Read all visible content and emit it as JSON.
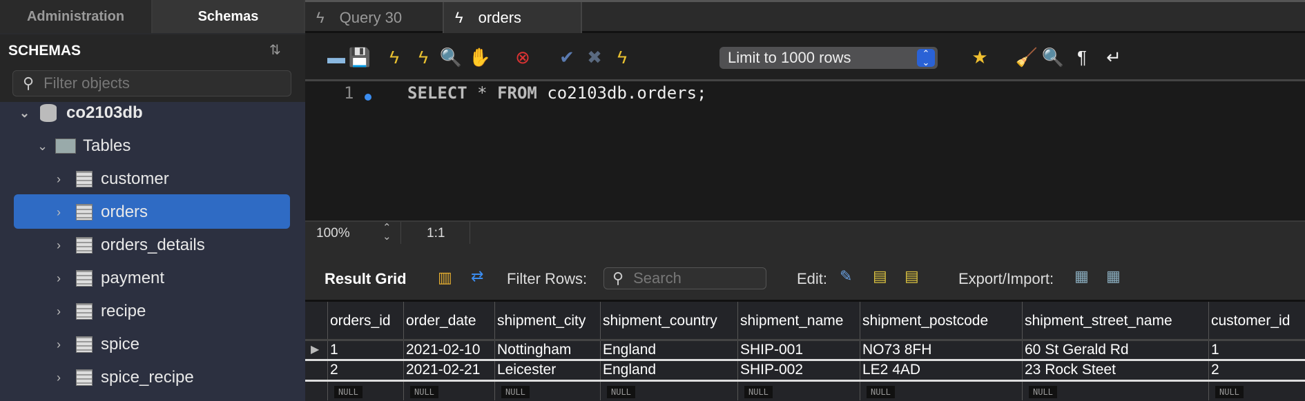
{
  "sidebar": {
    "tabs": [
      "Administration",
      "Schemas"
    ],
    "title": "SCHEMAS",
    "filter_placeholder": "Filter objects",
    "schema": "co2103db",
    "tables_label": "Tables",
    "tables": [
      "customer",
      "orders",
      "orders_details",
      "payment",
      "recipe",
      "spice",
      "spice_recipe"
    ],
    "selected": "orders"
  },
  "query_tabs": [
    "Query 30",
    "orders"
  ],
  "toolbar": {
    "limit": "Limit to 1000 rows",
    "icons": [
      "open-folder-icon",
      "save-icon",
      "execute-icon",
      "execute-current-icon",
      "explain-icon",
      "stop-icon",
      "toggle-error-icon",
      "commit-icon",
      "rollback-icon",
      "autocommit-icon",
      "add-snippet-icon",
      "beautify-icon",
      "find-icon",
      "invisible-chars-icon",
      "word-wrap-icon"
    ]
  },
  "editor": {
    "line": "1",
    "sql_keyword1": "SELECT",
    "sql_star": "*",
    "sql_keyword2": "FROM",
    "sql_rest": "co2103db.orders;"
  },
  "status": {
    "zoom": "100%",
    "position": "1:1"
  },
  "result": {
    "title": "Result Grid",
    "filter_label": "Filter Rows:",
    "search_placeholder": "Search",
    "edit_label": "Edit:",
    "export_label": "Export/Import:"
  },
  "grid": {
    "columns": [
      "orders_id",
      "order_date",
      "shipment_city",
      "shipment_country",
      "shipment_name",
      "shipment_postcode",
      "shipment_street_name",
      "customer_id"
    ],
    "rows": [
      [
        "1",
        "2021-02-10",
        "Nottingham",
        "England",
        "SHIP-001",
        "NO73 8FH",
        "60 St Gerald Rd",
        "1"
      ],
      [
        "2",
        "2021-02-21",
        "Leicester",
        "England",
        "SHIP-002",
        "LE2 4AD",
        "23 Rock Steet",
        "2"
      ]
    ],
    "null_label": "NULL"
  },
  "colors": {
    "selection": "#2f6bc4",
    "keyword": "#d0d0d0"
  }
}
